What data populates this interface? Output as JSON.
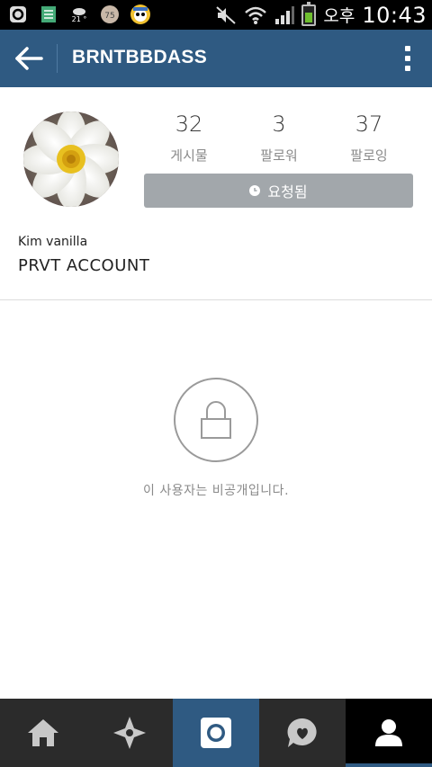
{
  "status_bar": {
    "left_icons": [
      "ollehtalk-icon",
      "memo-icon",
      "weather-icon",
      "kakao-icon",
      "pororo-icon"
    ],
    "weather_text": "21 °",
    "ampm": "오후",
    "time": "10:43"
  },
  "header": {
    "username": "BRNTBBDASS"
  },
  "profile": {
    "stats": [
      {
        "value": "32",
        "label": "게시물"
      },
      {
        "value": "3",
        "label": "팔로워"
      },
      {
        "value": "37",
        "label": "팔로잉"
      }
    ],
    "request_label": "요청됨",
    "full_name": "Kim vanilla",
    "bio": "PRVT ACCOUNT"
  },
  "private_notice": {
    "message": "이 사용자는 비공개입니다."
  },
  "bottom_nav": {
    "items": [
      "home-icon",
      "explore-icon",
      "camera-icon",
      "activity-icon",
      "profile-icon"
    ],
    "active": "profile-icon"
  },
  "colors": {
    "header_bg": "#2f5a82",
    "nav_bg": "#2b2b2b",
    "button_gray": "#a2a7ab"
  }
}
